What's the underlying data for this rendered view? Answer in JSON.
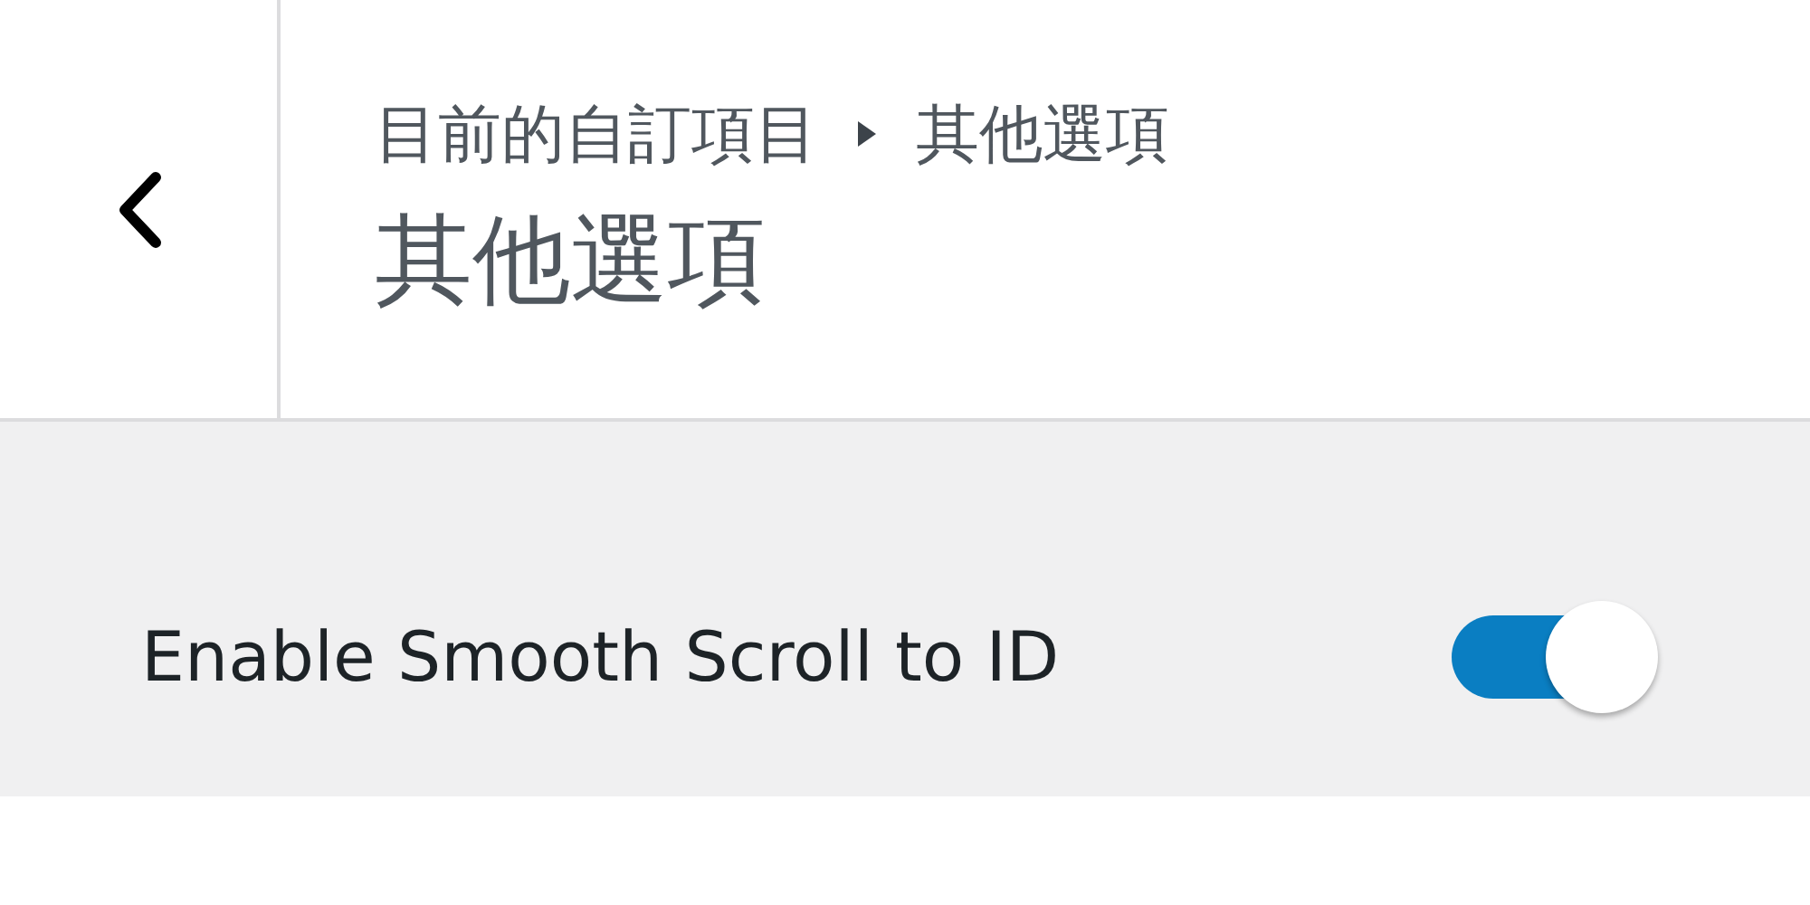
{
  "header": {
    "breadcrumb": [
      "目前的自訂項目",
      "其他選項"
    ],
    "title": "其他選項"
  },
  "settings": [
    {
      "kind": "toggle",
      "label": "Enable Smooth Scroll to ID",
      "on": true
    }
  ]
}
